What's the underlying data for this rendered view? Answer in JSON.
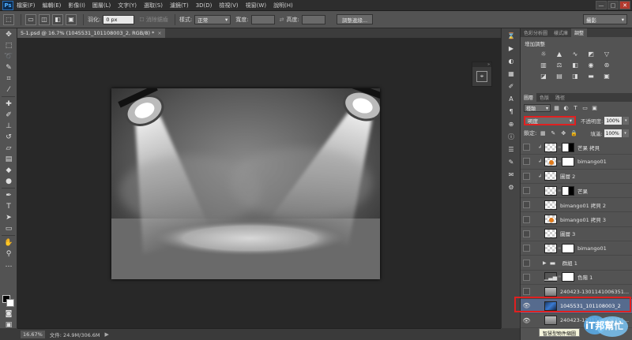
{
  "app": {
    "logo": "Ps"
  },
  "menubar": {
    "items": [
      "檔案(F)",
      "編輯(E)",
      "影像(I)",
      "圖層(L)",
      "文字(Y)",
      "選取(S)",
      "濾鏡(T)",
      "3D(D)",
      "檢視(V)",
      "視窗(W)",
      "說明(H)"
    ]
  },
  "window_controls": {
    "minimize": "—",
    "maximize": "□",
    "close": "✕"
  },
  "options": {
    "feather_label": "羽化:",
    "feather_value": "0 px",
    "antialias_label": "消除鋸齒",
    "style_label": "樣式:",
    "style_value": "正常",
    "width_label": "寬度:",
    "height_label": "高度:",
    "refine_button": "調整邊緣...",
    "workspace": "攝影"
  },
  "document": {
    "tab_title": "5-1.psd @ 16.7% (1045531_101108003_2, RGB/8) *",
    "close": "×"
  },
  "status": {
    "zoom": "16.67%",
    "doc_size": "文件: 24.9M/306.6M"
  },
  "adjustments": {
    "tabs": [
      "色彩分析圖",
      "樣式庫",
      "調整"
    ],
    "title": "增加調整",
    "icon_names": [
      "brightness-icon",
      "levels-icon",
      "curves-icon",
      "exposure-icon",
      "vibrance-icon",
      "hue-saturation-icon",
      "color-balance-icon",
      "black-white-icon",
      "photo-filter-icon",
      "channel-mixer-icon",
      "invert-icon",
      "posterize-icon",
      "threshold-icon",
      "gradient-map-icon",
      "selective-color-icon"
    ]
  },
  "layers_panel": {
    "tabs": [
      "圖層",
      "色版",
      "路徑"
    ],
    "filter_label": "種類",
    "blend_mode": "明度",
    "opacity_label": "不透明度:",
    "opacity_value": "100%",
    "lock_label": "鎖定:",
    "fill_label": "填滿:",
    "fill_value": "100%",
    "layers": [
      {
        "name": "芒果 拷貝",
        "visible": false,
        "clip": true,
        "thumb": "checker",
        "mask": "mixed"
      },
      {
        "name": "bimango01",
        "visible": false,
        "clip": true,
        "thumb": "orange",
        "mask": "plain"
      },
      {
        "name": "圖層 2",
        "visible": false,
        "clip": true,
        "thumb": "checker",
        "mask": ""
      },
      {
        "name": "芒果",
        "visible": false,
        "clip": false,
        "thumb": "checker",
        "mask": "mixed"
      },
      {
        "name": "bimango01 拷貝 2",
        "visible": false,
        "clip": false,
        "thumb": "checker",
        "mask": ""
      },
      {
        "name": "bimango01 拷貝 3",
        "visible": false,
        "clip": false,
        "thumb": "orange",
        "mask": ""
      },
      {
        "name": "圖層 3",
        "visible": false,
        "clip": false,
        "thumb": "checker",
        "mask": ""
      },
      {
        "name": "bimango01",
        "visible": false,
        "clip": false,
        "thumb": "checker",
        "mask": "plain"
      },
      {
        "name": "群組 1",
        "visible": false,
        "clip": false,
        "thumb": "folder",
        "mask": ""
      },
      {
        "name": "色階 1",
        "visible": false,
        "clip": false,
        "thumb": "hist",
        "mask": "plain"
      },
      {
        "name": "240423-1301141006351...",
        "visible": false,
        "clip": false,
        "thumb": "smart",
        "mask": ""
      },
      {
        "name": "1045531_101108003_2",
        "visible": true,
        "clip": false,
        "thumb": "photo",
        "mask": "",
        "selected": true
      },
      {
        "name": "240423-1301141006351...",
        "visible": true,
        "clip": false,
        "thumb": "smart",
        "mask": ""
      }
    ]
  },
  "tooltip": "智慧型物件縮圖",
  "watermark": "iT邦幫忙",
  "colors": {
    "highlight": "#e02020",
    "selected_layer": "#566b8e",
    "panel_bg": "#535353",
    "canvas_bg": "#282828"
  }
}
